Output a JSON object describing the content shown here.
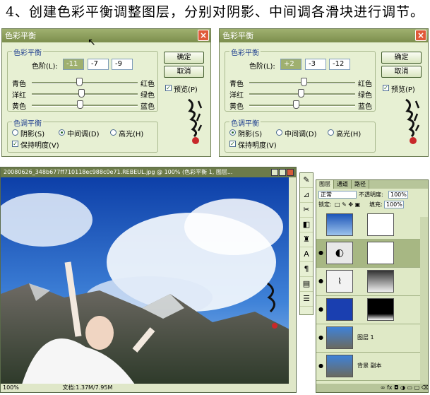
{
  "heading": "4、创建色彩平衡调整图层，分别对阴影、中间调各滑块进行调节。",
  "dialog_left": {
    "title": "色彩平衡",
    "section_balance": "色彩平衡",
    "levels_label": "色阶(L):",
    "levels": [
      "-11",
      "-7",
      "-9"
    ],
    "rows": [
      {
        "left": "青色",
        "right": "红色",
        "value": -11
      },
      {
        "left": "洋红",
        "right": "绿色",
        "value": -7
      },
      {
        "left": "黄色",
        "right": "蓝色",
        "value": -9
      }
    ],
    "section_tone": "色调平衡",
    "tone_options": [
      "阴影(S)",
      "中间调(D)",
      "高光(H)"
    ],
    "tone_selected": 1,
    "preserve_label": "保持明度(V)",
    "ok_label": "确定",
    "cancel_label": "取消",
    "preview_label": "预览(P)"
  },
  "dialog_right": {
    "title": "色彩平衡",
    "section_balance": "色彩平衡",
    "levels_label": "色阶(L):",
    "levels": [
      "+2",
      "-3",
      "-12"
    ],
    "rows": [
      {
        "left": "青色",
        "right": "红色",
        "value": 2
      },
      {
        "left": "洋红",
        "right": "绿色",
        "value": -3
      },
      {
        "left": "黄色",
        "right": "蓝色",
        "value": -12
      }
    ],
    "section_tone": "色调平衡",
    "tone_options": [
      "阴影(S)",
      "中间调(D)",
      "高光(H)"
    ],
    "tone_selected": 0,
    "preserve_label": "保持明度(V)",
    "ok_label": "确定",
    "cancel_label": "取消",
    "preview_label": "预览(P)"
  },
  "document": {
    "title": "20080626_348b677ff710118ec988c0e71.REBEUL.jpg @ 100% (色彩平衡 1, 图层...",
    "zoom": "100%",
    "doc_size": "文档:1.37M/7.95M"
  },
  "layers_panel": {
    "tabs": [
      "图层",
      "通道",
      "路径"
    ],
    "blend_mode": "正常",
    "opacity_label": "不透明度:",
    "opacity": "100%",
    "lock_label": "锁定:",
    "fill_label": "填充:",
    "fill": "100%",
    "layers": [
      {
        "name": ""
      },
      {
        "name": ""
      },
      {
        "name": ""
      },
      {
        "name": ""
      },
      {
        "name": "图层 1"
      },
      {
        "name": "背景 副本"
      }
    ]
  },
  "colors": {
    "dialog_bg": "#e7f0d3",
    "titlebar": "#8a9c58",
    "close": "#e05a3a"
  }
}
